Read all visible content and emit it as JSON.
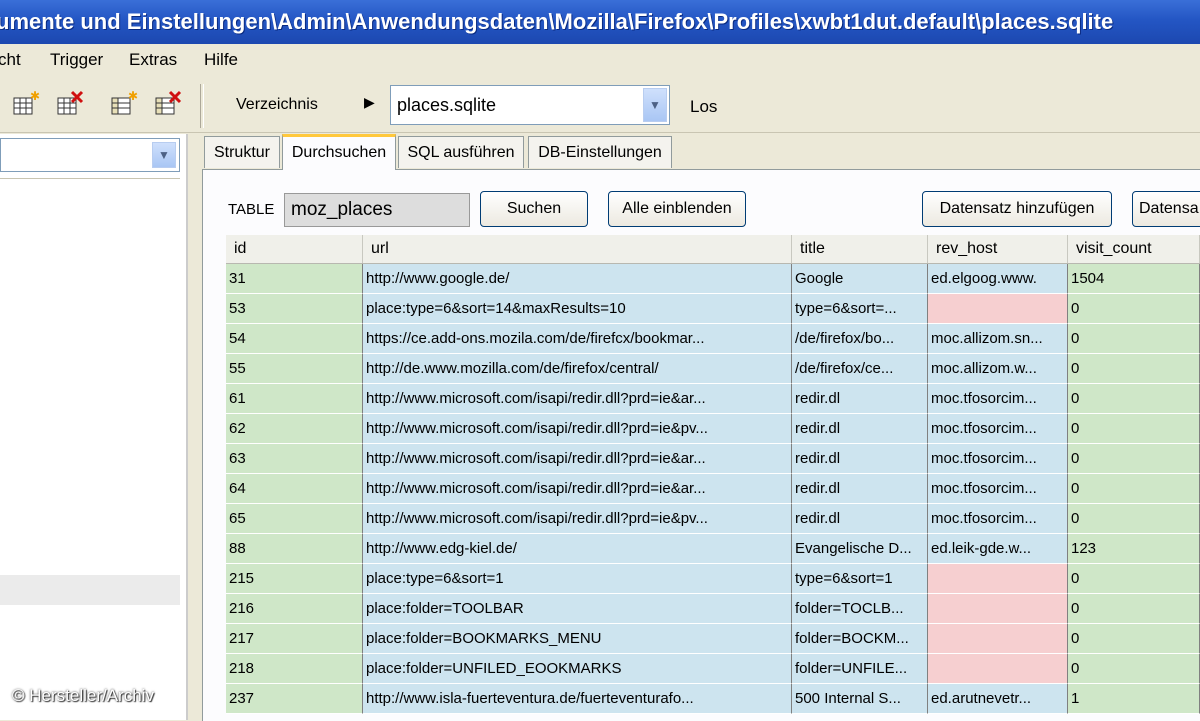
{
  "window": {
    "title": "umente und Einstellungen\\Admin\\Anwendungsdaten\\Mozilla\\Firefox\\Profiles\\xwbt1dut.default\\places.sqlite"
  },
  "menu": [
    "cht",
    "Trigger",
    "Extras",
    "Hilfe"
  ],
  "toolbar": {
    "verzeichnis_label": "Verzeichnis",
    "db_select_value": "places.sqlite",
    "go_label": "Los",
    "icons": [
      "table-new-icon",
      "table-delete-icon",
      "index-new-icon",
      "index-delete-icon"
    ]
  },
  "tabs": [
    {
      "label": "Struktur",
      "active": false
    },
    {
      "label": "Durchsuchen",
      "active": true
    },
    {
      "label": "SQL ausführen",
      "active": false
    },
    {
      "label": "DB-Einstellungen",
      "active": false
    }
  ],
  "browse": {
    "table_label": "TABLE",
    "table_value": "moz_places",
    "search_button": "Suchen",
    "show_all_button": "Alle einblenden",
    "add_record_button": "Datensatz hinzufügen",
    "delete_record_button": "Datensa"
  },
  "grid": {
    "columns": [
      "id",
      "url",
      "title",
      "rev_host",
      "visit_count"
    ],
    "rows": [
      {
        "id": "31",
        "url": "http://www.google.de/",
        "title": "Google",
        "rev_host": "ed.elgoog.www.",
        "visit_count": "1504"
      },
      {
        "id": "53",
        "url": "place:type=6&sort=14&maxResults=10",
        "title": "type=6&sort=...",
        "rev_host": "",
        "visit_count": "0"
      },
      {
        "id": "54",
        "url": "https://ce.add-ons.mozila.com/de/firefcx/bookmar...",
        "title": "/de/firefox/bo...",
        "rev_host": "moc.allizom.sn...",
        "visit_count": "0"
      },
      {
        "id": "55",
        "url": "http://de.www.mozilla.com/de/firefox/central/",
        "title": "/de/firefox/ce...",
        "rev_host": "moc.allizom.w...",
        "visit_count": "0"
      },
      {
        "id": "61",
        "url": "http://www.microsoft.com/isapi/redir.dll?prd=ie&ar...",
        "title": "redir.dl",
        "rev_host": "moc.tfosorcim...",
        "visit_count": "0"
      },
      {
        "id": "62",
        "url": "http://www.microsoft.com/isapi/redir.dll?prd=ie&pv...",
        "title": "redir.dl",
        "rev_host": "moc.tfosorcim...",
        "visit_count": "0"
      },
      {
        "id": "63",
        "url": "http://www.microsoft.com/isapi/redir.dll?prd=ie&ar...",
        "title": "redir.dl",
        "rev_host": "moc.tfosorcim...",
        "visit_count": "0"
      },
      {
        "id": "64",
        "url": "http://www.microsoft.com/isapi/redir.dll?prd=ie&ar...",
        "title": "redir.dl",
        "rev_host": "moc.tfosorcim...",
        "visit_count": "0"
      },
      {
        "id": "65",
        "url": "http://www.microsoft.com/isapi/redir.dll?prd=ie&pv...",
        "title": "redir.dl",
        "rev_host": "moc.tfosorcim...",
        "visit_count": "0"
      },
      {
        "id": "88",
        "url": "http://www.edg-kiel.de/",
        "title": "Evangelische D...",
        "rev_host": "ed.leik-gde.w...",
        "visit_count": "123"
      },
      {
        "id": "215",
        "url": "place:type=6&sort=1",
        "title": "type=6&sort=1",
        "rev_host": "",
        "visit_count": "0"
      },
      {
        "id": "216",
        "url": "place:folder=TOOLBAR",
        "title": "folder=TOCLB...",
        "rev_host": "",
        "visit_count": "0"
      },
      {
        "id": "217",
        "url": "place:folder=BOOKMARKS_MENU",
        "title": "folder=BOCKM...",
        "rev_host": "",
        "visit_count": "0"
      },
      {
        "id": "218",
        "url": "place:folder=UNFILED_EOOKMARKS",
        "title": "folder=UNFILE...",
        "rev_host": "",
        "visit_count": "0"
      },
      {
        "id": "237",
        "url": "http://www.isla-fuerteventura.de/fuerteventurafo...",
        "title": "500 Internal S...",
        "rev_host": "ed.arutnevetr...",
        "visit_count": "1"
      }
    ]
  },
  "watermark": "© Hersteller/Archiv",
  "colors": {
    "id_col": "#cfe7c8",
    "text_col": "#cde4ef",
    "null_cell": "#f6cfd0",
    "titlebar": "#2456c4"
  }
}
